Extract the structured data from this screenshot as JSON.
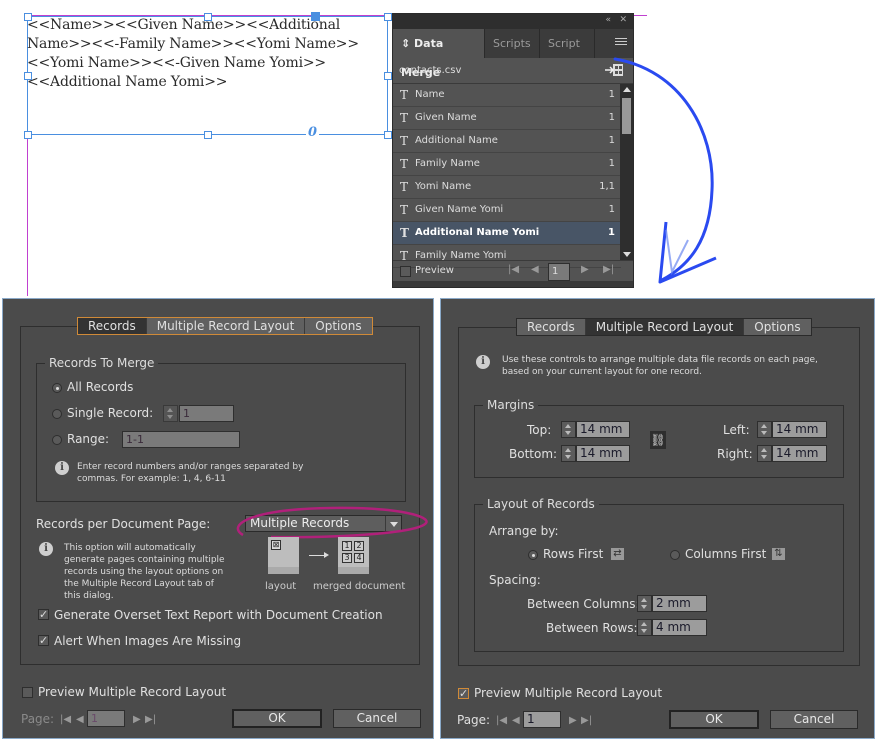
{
  "document": {
    "text_frame_content": "<<Name>><<Given Name>><<Additional Name>><<-Family Name>><<Yomi Name>><<Yomi Name>><<-Given Name Yomi>><<Additional Name Yomi>>",
    "frame_marker": "0"
  },
  "data_merge_panel": {
    "tabs": [
      {
        "label": "Data Merge",
        "active": true
      },
      {
        "label": "Scripts",
        "active": false
      },
      {
        "label": "Script La",
        "active": false
      }
    ],
    "collapse_glyph": "«",
    "close_glyph": "✕",
    "source_file": "contacts.csv",
    "fields": [
      {
        "name": "Name",
        "count": "1",
        "selected": false
      },
      {
        "name": "Given Name",
        "count": "1",
        "selected": false
      },
      {
        "name": "Additional Name",
        "count": "1",
        "selected": false
      },
      {
        "name": "Family Name",
        "count": "1",
        "selected": false
      },
      {
        "name": "Yomi Name",
        "count": "1,1",
        "selected": false
      },
      {
        "name": "Given Name Yomi",
        "count": "1",
        "selected": false
      },
      {
        "name": "Additional Name Yomi",
        "count": "1",
        "selected": true
      },
      {
        "name": "Family Name Yomi",
        "count": "",
        "selected": false
      }
    ],
    "field_type_glyph": "T",
    "preview_label": "Preview",
    "preview_checked": false,
    "record_number": "1"
  },
  "records_dialog": {
    "tabs": [
      {
        "label": "Records",
        "active": true
      },
      {
        "label": "Multiple Record Layout",
        "active": false
      },
      {
        "label": "Options",
        "active": false
      }
    ],
    "records_to_merge_label": "Records To Merge",
    "all_records_label": "All Records",
    "single_record_label": "Single Record:",
    "single_record_value": "1",
    "range_label": "Range:",
    "range_value": "1-1",
    "selected_option": "All Records",
    "range_hint_line1": "Enter record numbers and/or ranges separated by",
    "range_hint_line2": "commas. For example: 1, 4, 6-11",
    "records_per_page_label": "Records per Document Page:",
    "records_per_page_value": "Multiple Records",
    "multiple_info_lines": [
      "This option will automatically",
      "generate pages containing multiple",
      "records using the layout options on",
      "the Multiple Record Layout tab of",
      "this dialog."
    ],
    "layout_caption": "layout",
    "merged_caption": "merged document",
    "merged_cells": [
      "1",
      "2",
      "3",
      "4"
    ],
    "overset_report_label": "Generate Overset Text Report with Document Creation",
    "overset_report_checked": true,
    "alert_images_label": "Alert When Images Are Missing",
    "alert_images_checked": true,
    "preview_label": "Preview Multiple Record Layout",
    "preview_checked": false,
    "page_label": "Page:",
    "page_value": "1",
    "ok_label": "OK",
    "cancel_label": "Cancel"
  },
  "layout_dialog": {
    "tabs": [
      {
        "label": "Records",
        "active": false
      },
      {
        "label": "Multiple Record Layout",
        "active": true
      },
      {
        "label": "Options",
        "active": false
      }
    ],
    "info_line1": "Use these controls to arrange multiple data file records on each page,",
    "info_line2": "based on your current layout for one record.",
    "margins_label": "Margins",
    "top_label": "Top:",
    "top_value": "14 mm",
    "bottom_label": "Bottom:",
    "bottom_value": "14 mm",
    "left_label": "Left:",
    "left_value": "14 mm",
    "right_label": "Right:",
    "right_value": "14 mm",
    "layout_of_records_label": "Layout of Records",
    "arrange_by_label": "Arrange by:",
    "rows_first_label": "Rows First",
    "columns_first_label": "Columns First",
    "arrange_selected": "Rows First",
    "spacing_label": "Spacing:",
    "between_columns_label": "Between Columns:",
    "between_columns_value": "2 mm",
    "between_rows_label": "Between Rows:",
    "between_rows_value": "4 mm",
    "preview_label": "Preview Multiple Record Layout",
    "preview_checked": true,
    "page_label": "Page:",
    "page_value": "1",
    "ok_label": "OK",
    "cancel_label": "Cancel"
  },
  "colors": {
    "selection_blue": "#4a8fe0",
    "guide_magenta": "#c040d0",
    "annotation_arrow": "#2a4af0",
    "annotation_ellipse": "#b0207a",
    "tab_focus_orange": "#d08a38",
    "dialog_bg": "#4b4b4b",
    "panel_selected_row": "#485566"
  }
}
